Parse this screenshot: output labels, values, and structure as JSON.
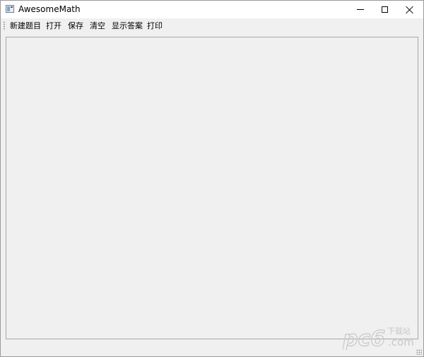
{
  "window": {
    "title": "AwesomeMath"
  },
  "toolbar": {
    "items": [
      {
        "label": "新建题目"
      },
      {
        "label": "打开"
      },
      {
        "label": "保存"
      },
      {
        "label": "清空"
      },
      {
        "label": "显示答案"
      },
      {
        "label": "打印"
      }
    ]
  },
  "watermark": {
    "brand": "pc6",
    "tagline": "下载站",
    "domain": ".com"
  },
  "colors": {
    "background": "#f0f0f0",
    "titlebar": "#ffffff",
    "panel_border": "#a8a8a8",
    "watermark": "#c8c8c8"
  },
  "icons": {
    "app": "app-window-icon",
    "minimize": "minimize-icon",
    "maximize": "maximize-icon",
    "close": "close-icon"
  }
}
